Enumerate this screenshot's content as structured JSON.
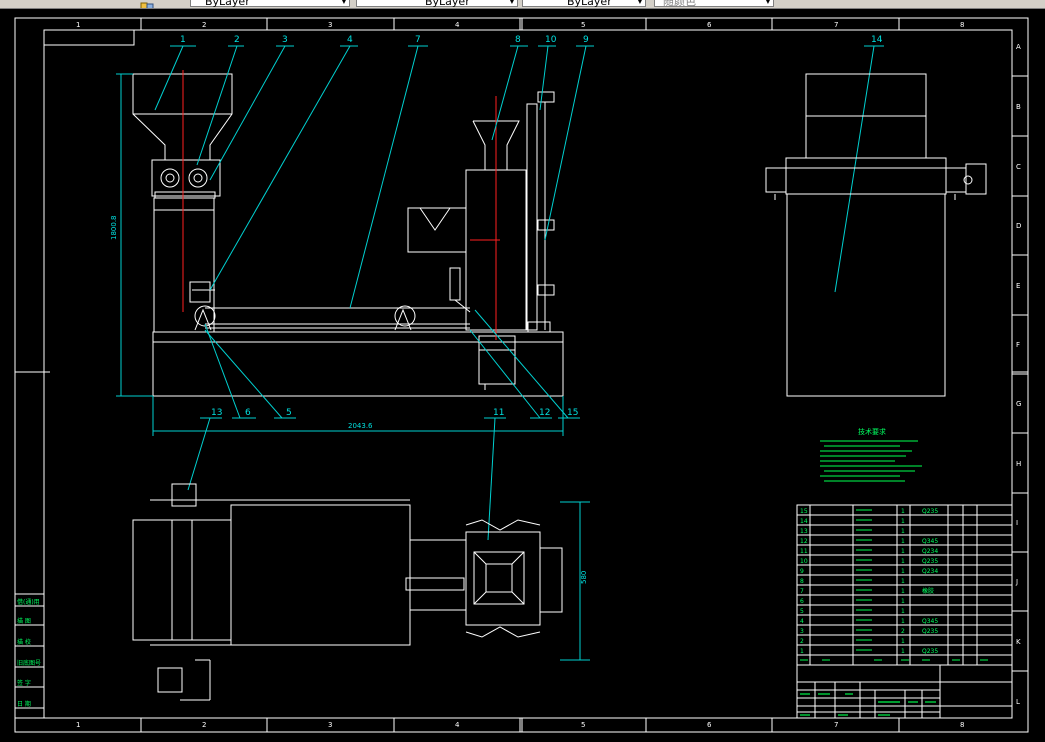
{
  "toolbar": {
    "layer_control_1": "ByLayer",
    "layer_control_2": "ByLayer",
    "layer_control_3": "ByLayer",
    "style_control": "随颜色"
  },
  "frame": {
    "col_labels": [
      "1",
      "2",
      "3",
      "4",
      "5",
      "6",
      "7",
      "8"
    ],
    "row_labels": [
      "A",
      "B",
      "C",
      "D",
      "E",
      "F",
      "G",
      "H",
      "I",
      "J",
      "K",
      "L"
    ]
  },
  "dimensions": {
    "height": "1800.8",
    "length": "2043.6",
    "width": "580"
  },
  "part_callouts": [
    "1",
    "2",
    "3",
    "4",
    "7",
    "8",
    "10",
    "9",
    "14",
    "6",
    "5",
    "12",
    "15",
    "13",
    "11"
  ],
  "tech_notes": {
    "title": "技术要求"
  },
  "sidebar_labels": [
    "借(通)用",
    "描 图",
    "描 校",
    "旧底图号",
    "签 字",
    "日 期"
  ],
  "bom": {
    "rows": [
      {
        "no": "15",
        "qty": "1",
        "mat": "Q235"
      },
      {
        "no": "14",
        "qty": "1",
        "mat": ""
      },
      {
        "no": "13",
        "qty": "1",
        "mat": ""
      },
      {
        "no": "12",
        "qty": "1",
        "mat": "Q345"
      },
      {
        "no": "11",
        "qty": "1",
        "mat": "Q234"
      },
      {
        "no": "10",
        "qty": "1",
        "mat": "Q235"
      },
      {
        "no": "9",
        "qty": "1",
        "mat": "Q234"
      },
      {
        "no": "8",
        "qty": "1",
        "mat": ""
      },
      {
        "no": "7",
        "qty": "1",
        "mat": "橡胶"
      },
      {
        "no": "6",
        "qty": "1",
        "mat": ""
      },
      {
        "no": "5",
        "qty": "1",
        "mat": ""
      },
      {
        "no": "4",
        "qty": "1",
        "mat": "Q345"
      },
      {
        "no": "3",
        "qty": "2",
        "mat": "Q235"
      },
      {
        "no": "2",
        "qty": "1",
        "mat": ""
      },
      {
        "no": "1",
        "qty": "1",
        "mat": "Q235"
      }
    ]
  }
}
